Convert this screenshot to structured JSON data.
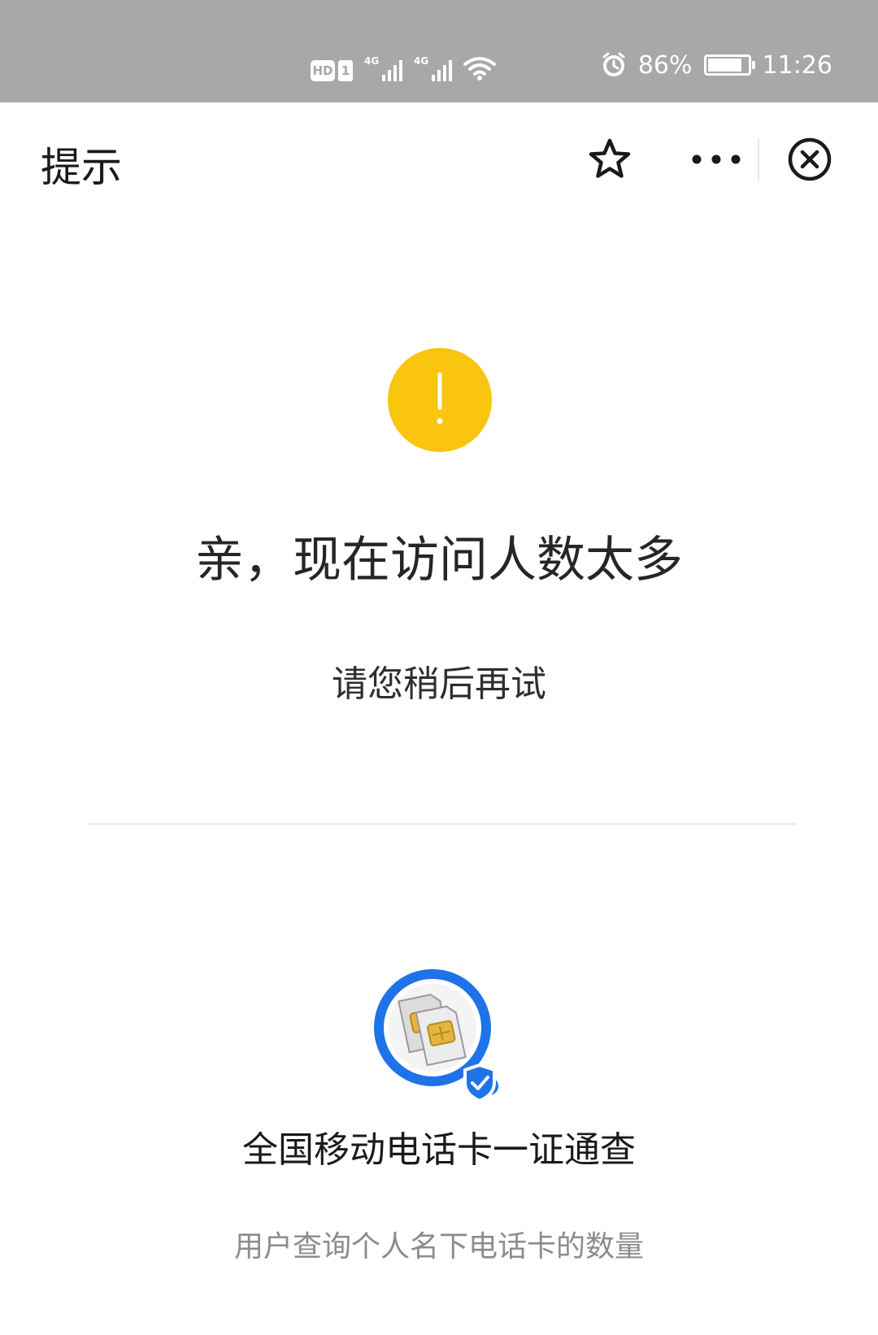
{
  "status_bar": {
    "hd_label": "HD",
    "sim_label": "1",
    "network_1": "4G",
    "network_2": "4G",
    "battery_text": "86%",
    "battery_level": 0.86,
    "time": "11:26"
  },
  "header": {
    "title": "提示"
  },
  "notice": {
    "title": "亲，现在访问人数太多",
    "subtitle": "请您稍后再试"
  },
  "service": {
    "name": "全国移动电话卡一证通查",
    "description": "用户查询个人名下电话卡的数量"
  },
  "colors": {
    "status_bar": "#a8a8a8",
    "warning": "#f9c50f",
    "brand_blue": "#1e73e8",
    "chip_gold": "#e4b53b"
  },
  "icons": {
    "star": "star-icon",
    "more": "more-icon",
    "close": "close-icon",
    "warning": "warning-icon",
    "service": "sim-card-search-icon"
  }
}
